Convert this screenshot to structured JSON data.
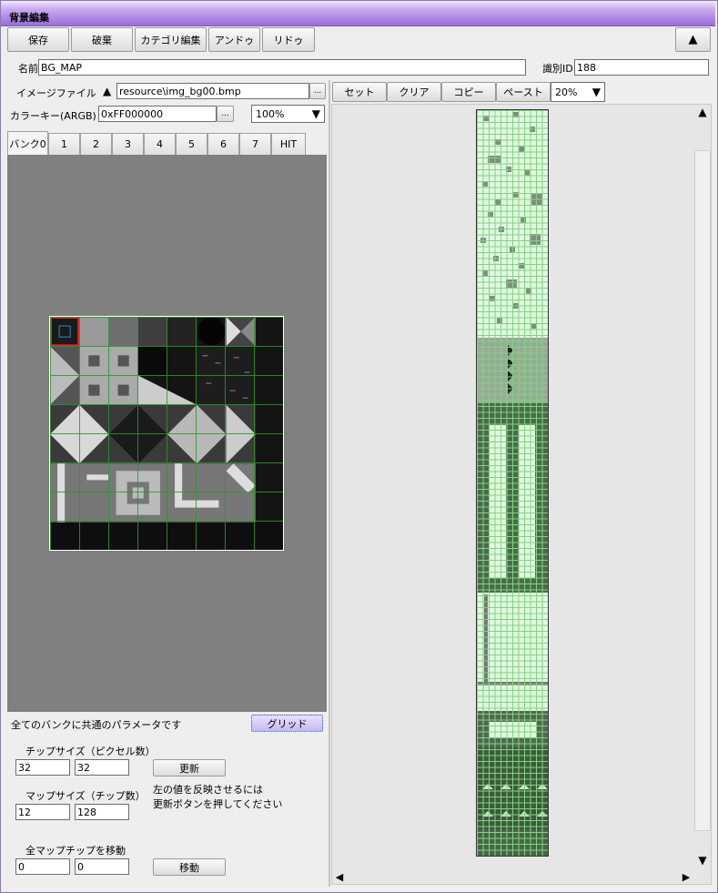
{
  "window": {
    "title": "背景編集"
  },
  "toolbar": {
    "save": "保存",
    "discard": "破棄",
    "category": "カテゴリ編集",
    "undo": "アンドゥ",
    "redo": "リドゥ",
    "collapse": "▲"
  },
  "name": {
    "label": "名前",
    "value": "BG_MAP"
  },
  "id": {
    "label": "識別ID",
    "value": "188"
  },
  "image_file": {
    "label": "イメージファイル",
    "sort": "▲",
    "value": "resource\\img_bg00.bmp",
    "browse": "..."
  },
  "colorkey": {
    "label": "カラーキー(ARGB)",
    "value": "0xFF000000",
    "browse": "...",
    "zoom": "100%",
    "zoom_arrow": "▼"
  },
  "banks": {
    "tabs": [
      "バンク0",
      "1",
      "2",
      "3",
      "4",
      "5",
      "6",
      "7",
      "HIT"
    ],
    "active": "バンク0"
  },
  "bottom": {
    "common_note": "全てのバンクに共通のパラメータです",
    "grid_button": "グリッド",
    "chip_size_label": "チップサイズ（ピクセル数）",
    "chip_w": "32",
    "chip_h": "32",
    "update_button": "更新",
    "map_size_label": "マップサイズ（チップ数）",
    "map_w": "12",
    "map_h": "128",
    "reflect_note1": "左の値を反映させるには",
    "reflect_note2": "更新ボタンを押してください",
    "move_label": "全マップチップを移動",
    "move_x": "0",
    "move_y": "0",
    "move_button": "移動"
  },
  "map_toolbar": {
    "set": "セット",
    "clear": "クリア",
    "copy": "コピー",
    "paste": "ペースト",
    "zoom": "20%",
    "zoom_arrow": "▼"
  },
  "scroll": {
    "up": "▲",
    "down": "▼",
    "left": "◀",
    "right": "▶"
  },
  "colors": {
    "title_accent": "#9a6ed8",
    "grid": "#2a9a2a",
    "map_bg": "#dff5df"
  }
}
